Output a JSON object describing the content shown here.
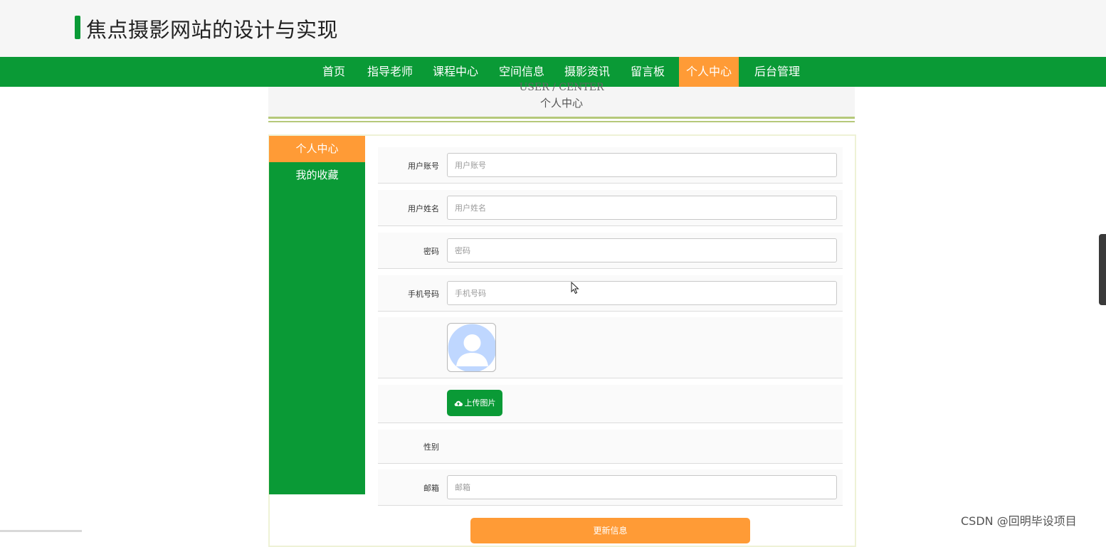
{
  "header": {
    "site_title": "焦点摄影网站的设计与实现"
  },
  "nav": {
    "items": [
      {
        "label": "首页"
      },
      {
        "label": "指导老师"
      },
      {
        "label": "课程中心"
      },
      {
        "label": "空间信息"
      },
      {
        "label": "摄影资讯"
      },
      {
        "label": "留言板"
      },
      {
        "label": "个人中心",
        "active": true
      },
      {
        "label": "后台管理"
      }
    ]
  },
  "section": {
    "title_en": "USER / CENTER",
    "title_cn": "个人中心"
  },
  "sidebar": {
    "items": [
      {
        "label": "个人中心",
        "active": true
      },
      {
        "label": "我的收藏"
      }
    ]
  },
  "form": {
    "username": {
      "label": "用户账号",
      "placeholder": "用户账号",
      "value": ""
    },
    "fullname": {
      "label": "用户姓名",
      "placeholder": "用户姓名",
      "value": ""
    },
    "password": {
      "label": "密码",
      "placeholder": "密码",
      "value": ""
    },
    "phone": {
      "label": "手机号码",
      "placeholder": "手机号码",
      "value": ""
    },
    "avatar": {
      "icon": "default-avatar-icon"
    },
    "upload": {
      "label": "上传图片",
      "icon": "cloud-upload-icon"
    },
    "gender": {
      "label": "性别",
      "value": ""
    },
    "email": {
      "label": "邮箱",
      "placeholder": "邮箱",
      "value": ""
    },
    "submit_label": "更新信息"
  },
  "watermark": "CSDN @回明毕设项目",
  "colors": {
    "primary_green": "#0a9a36",
    "accent_orange": "#ff9b36",
    "header_bg": "#f6f6f6"
  }
}
